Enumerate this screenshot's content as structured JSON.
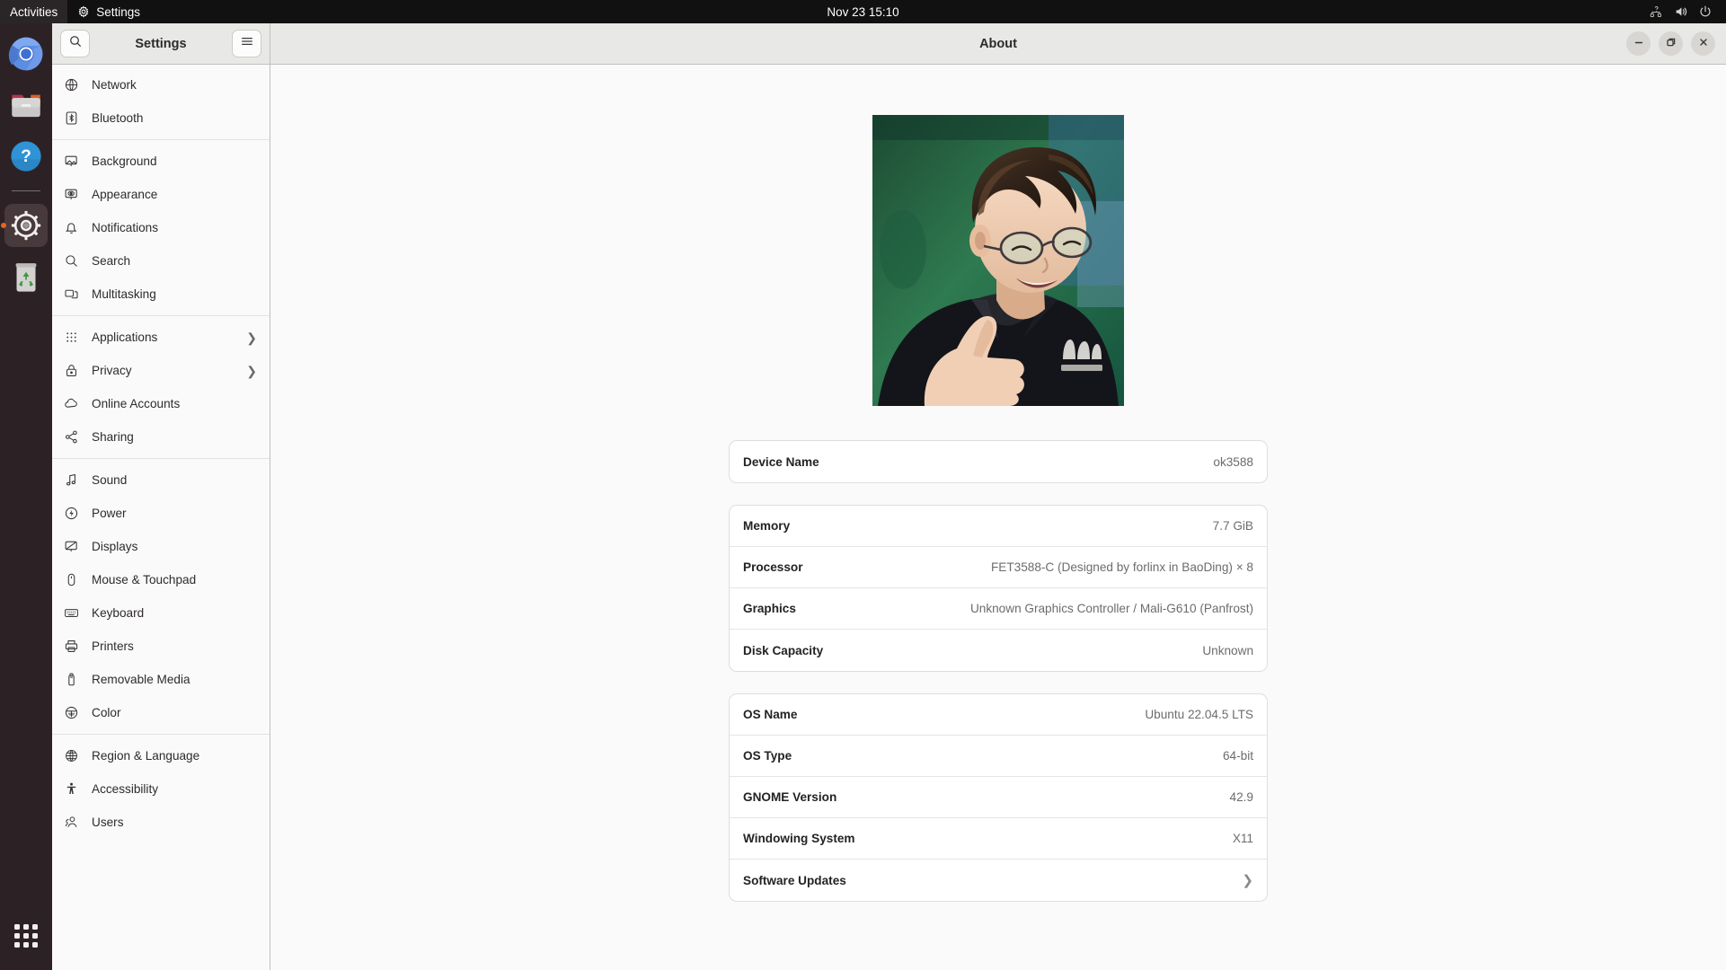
{
  "topbar": {
    "activities_label": "Activities",
    "app_menu_label": "Settings",
    "app_menu_icon": "gear-icon",
    "clock": "Nov 23  15:10",
    "system_icons": [
      {
        "name": "network-unknown-icon",
        "glyph": "network"
      },
      {
        "name": "volume-icon",
        "glyph": "volume"
      },
      {
        "name": "power-icon",
        "glyph": "power"
      }
    ]
  },
  "dock": {
    "items": [
      {
        "name": "chromium",
        "label": "Chromium",
        "icon": "chromium-icon",
        "active": false
      },
      {
        "name": "files",
        "label": "Files",
        "icon": "files-folder-icon",
        "active": false
      },
      {
        "name": "help",
        "label": "Help",
        "icon": "help-question-icon",
        "active": false
      },
      {
        "name": "settings",
        "label": "Settings",
        "icon": "settings-gear-icon",
        "active": true
      },
      {
        "name": "trash",
        "label": "Trash",
        "icon": "trash-recycle-icon",
        "active": false
      }
    ],
    "show_apps_label": "Show Applications"
  },
  "window": {
    "sidebar_title": "Settings",
    "page_title": "About",
    "search_icon": "search-icon",
    "menu_icon": "hamburger-menu-icon",
    "controls": {
      "minimize": "minimize-icon",
      "maximize": "maximize-icon",
      "close": "close-icon"
    }
  },
  "sidebar": {
    "groups": [
      {
        "items": [
          {
            "label": "Network",
            "icon": "network-globe-icon",
            "chevron": false
          },
          {
            "label": "Bluetooth",
            "icon": "bluetooth-icon",
            "chevron": false
          }
        ]
      },
      {
        "items": [
          {
            "label": "Background",
            "icon": "background-monitor-icon",
            "chevron": false
          },
          {
            "label": "Appearance",
            "icon": "appearance-icon",
            "chevron": false
          },
          {
            "label": "Notifications",
            "icon": "bell-icon",
            "chevron": false
          },
          {
            "label": "Search",
            "icon": "search-icon",
            "chevron": false
          },
          {
            "label": "Multitasking",
            "icon": "multitasking-windows-icon",
            "chevron": false
          }
        ]
      },
      {
        "items": [
          {
            "label": "Applications",
            "icon": "applications-grid-icon",
            "chevron": true
          },
          {
            "label": "Privacy",
            "icon": "lock-icon",
            "chevron": true
          },
          {
            "label": "Online Accounts",
            "icon": "cloud-icon",
            "chevron": false
          },
          {
            "label": "Sharing",
            "icon": "share-nodes-icon",
            "chevron": false
          }
        ]
      },
      {
        "items": [
          {
            "label": "Sound",
            "icon": "music-note-icon",
            "chevron": false
          },
          {
            "label": "Power",
            "icon": "power-bolt-icon",
            "chevron": false
          },
          {
            "label": "Displays",
            "icon": "display-monitor-icon",
            "chevron": false
          },
          {
            "label": "Mouse & Touchpad",
            "icon": "mouse-icon",
            "chevron": false
          },
          {
            "label": "Keyboard",
            "icon": "keyboard-icon",
            "chevron": false
          },
          {
            "label": "Printers",
            "icon": "printer-icon",
            "chevron": false
          },
          {
            "label": "Removable Media",
            "icon": "usb-drive-icon",
            "chevron": false
          },
          {
            "label": "Color",
            "icon": "color-wheel-icon",
            "chevron": false
          }
        ]
      },
      {
        "items": [
          {
            "label": "Region & Language",
            "icon": "globe-grid-icon",
            "chevron": false
          },
          {
            "label": "Accessibility",
            "icon": "accessibility-person-icon",
            "chevron": false
          },
          {
            "label": "Users",
            "icon": "users-people-icon",
            "chevron": false
          }
        ]
      }
    ]
  },
  "about": {
    "photo_alt": "device-photo",
    "device": {
      "rows": [
        {
          "key": "Device Name",
          "value": "ok3588",
          "chevron": false
        }
      ]
    },
    "hardware": {
      "rows": [
        {
          "key": "Memory",
          "value": "7.7 GiB",
          "chevron": false
        },
        {
          "key": "Processor",
          "value": "FET3588-C (Designed by forlinx in BaoDing) × 8",
          "chevron": false
        },
        {
          "key": "Graphics",
          "value": "Unknown Graphics Controller / Mali-G610 (Panfrost)",
          "chevron": false
        },
        {
          "key": "Disk Capacity",
          "value": "Unknown",
          "chevron": false
        }
      ]
    },
    "software": {
      "rows": [
        {
          "key": "OS Name",
          "value": "Ubuntu 22.04.5 LTS",
          "chevron": false
        },
        {
          "key": "OS Type",
          "value": "64-bit",
          "chevron": false
        },
        {
          "key": "GNOME Version",
          "value": "42.9",
          "chevron": false
        },
        {
          "key": "Windowing System",
          "value": "X11",
          "chevron": false
        },
        {
          "key": "Software Updates",
          "value": "",
          "chevron": true
        }
      ]
    }
  },
  "colors": {
    "topbar_bg": "#111111",
    "dock_bg": "#2c2225",
    "accent_orange": "#e8641e",
    "headerbar_bg": "#e8e8e7",
    "content_bg": "#fafafa",
    "card_bg": "#ffffff",
    "border": "#c2c0bd"
  }
}
